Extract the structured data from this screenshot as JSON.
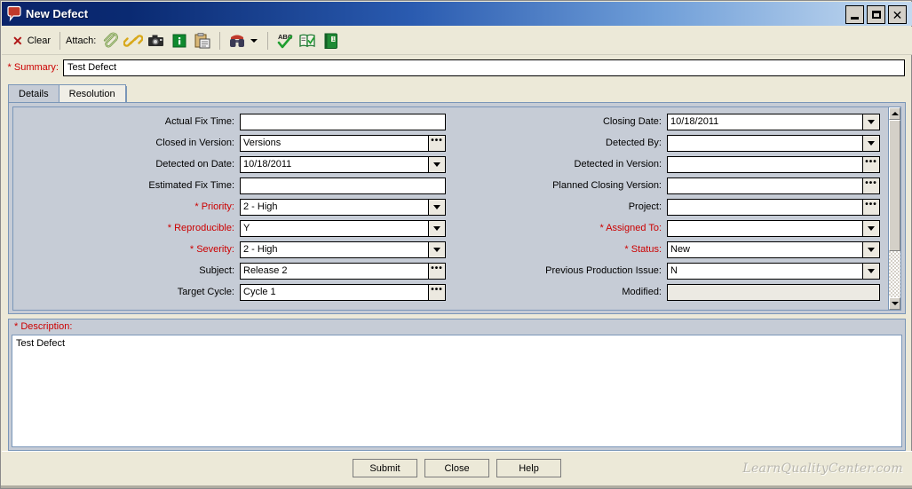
{
  "window": {
    "title": "New Defect",
    "icon": "defect-balloon-icon",
    "controls": {
      "minimize": "_",
      "maximize": "□",
      "close": "✕"
    }
  },
  "toolbar": {
    "clear_label": "Clear",
    "clear_icon": "red-x-icon",
    "attach_label": "Attach:",
    "icons": [
      {
        "name": "paperclip-icon",
        "glyph": "attachment"
      },
      {
        "name": "link-icon",
        "glyph": "url-link"
      },
      {
        "name": "camera-icon",
        "glyph": "snapshot"
      },
      {
        "name": "system-info-icon",
        "glyph": "info"
      },
      {
        "name": "clipboard-icon",
        "glyph": "paste"
      },
      {
        "name": "find-similar-defects-icon",
        "glyph": "binoculars"
      },
      {
        "name": "spell-check-icon",
        "glyph": "abc-check"
      },
      {
        "name": "thesaurus-icon",
        "glyph": "book-check"
      },
      {
        "name": "spelling-options-icon",
        "glyph": "green-book"
      }
    ]
  },
  "summary": {
    "label": "* Summary:",
    "value": "Test Defect",
    "placeholder": ""
  },
  "tabs": [
    {
      "label": "Details",
      "active": true
    },
    {
      "label": "Resolution",
      "active": false
    }
  ],
  "details": {
    "left_fields": [
      {
        "label": "Actual Fix Time:",
        "value": "",
        "control": "text",
        "required": false,
        "disabled": false
      },
      {
        "label": "Closed in Version:",
        "value": "Versions",
        "control": "ellipsis",
        "required": false,
        "disabled": false
      },
      {
        "label": "Detected on Date:",
        "value": "10/18/2011",
        "control": "dropdown",
        "required": false,
        "disabled": false
      },
      {
        "label": "Estimated Fix Time:",
        "value": "",
        "control": "text",
        "required": false,
        "disabled": false
      },
      {
        "label": "* Priority:",
        "value": "2 - High",
        "control": "dropdown",
        "required": true,
        "disabled": false
      },
      {
        "label": "* Reproducible:",
        "value": "Y",
        "control": "dropdown",
        "required": true,
        "disabled": false
      },
      {
        "label": "* Severity:",
        "value": "2 - High",
        "control": "dropdown",
        "required": true,
        "disabled": false
      },
      {
        "label": "Subject:",
        "value": "Release 2",
        "control": "ellipsis",
        "required": false,
        "disabled": false
      },
      {
        "label": "Target Cycle:",
        "value": "Cycle 1",
        "control": "ellipsis",
        "required": false,
        "disabled": false
      }
    ],
    "right_fields": [
      {
        "label": "Closing Date:",
        "value": "10/18/2011",
        "control": "dropdown",
        "required": false,
        "disabled": false
      },
      {
        "label": "Detected By:",
        "value": "",
        "control": "dropdown",
        "required": false,
        "disabled": false
      },
      {
        "label": "Detected in Version:",
        "value": "",
        "control": "ellipsis",
        "required": false,
        "disabled": false
      },
      {
        "label": "Planned Closing Version:",
        "value": "",
        "control": "ellipsis",
        "required": false,
        "disabled": false
      },
      {
        "label": "Project:",
        "value": "",
        "control": "ellipsis",
        "required": false,
        "disabled": false
      },
      {
        "label": "* Assigned To:",
        "value": "",
        "control": "dropdown",
        "required": true,
        "disabled": false
      },
      {
        "label": "* Status:",
        "value": "New",
        "control": "dropdown",
        "required": true,
        "disabled": false
      },
      {
        "label": "Previous Production Issue:",
        "value": "N",
        "control": "dropdown",
        "required": false,
        "disabled": false
      },
      {
        "label": "Modified:",
        "value": "",
        "control": "none",
        "required": false,
        "disabled": true
      }
    ],
    "scrollbar": {
      "up_icon": "scroll-up-icon",
      "down_icon": "scroll-down-icon"
    }
  },
  "description": {
    "label": "* Description:",
    "value": "Test Defect"
  },
  "footer": {
    "buttons": [
      {
        "label": "Submit"
      },
      {
        "label": "Close"
      },
      {
        "label": "Help"
      }
    ],
    "watermark": "LearnQualityCenter.com"
  },
  "colors": {
    "required_red": "#cc0000",
    "title_blue": "#0a246a",
    "panel_bg": "#c6ccd6",
    "panel_border": "#7a96b8",
    "toolbar_bg": "#ece9d8"
  }
}
